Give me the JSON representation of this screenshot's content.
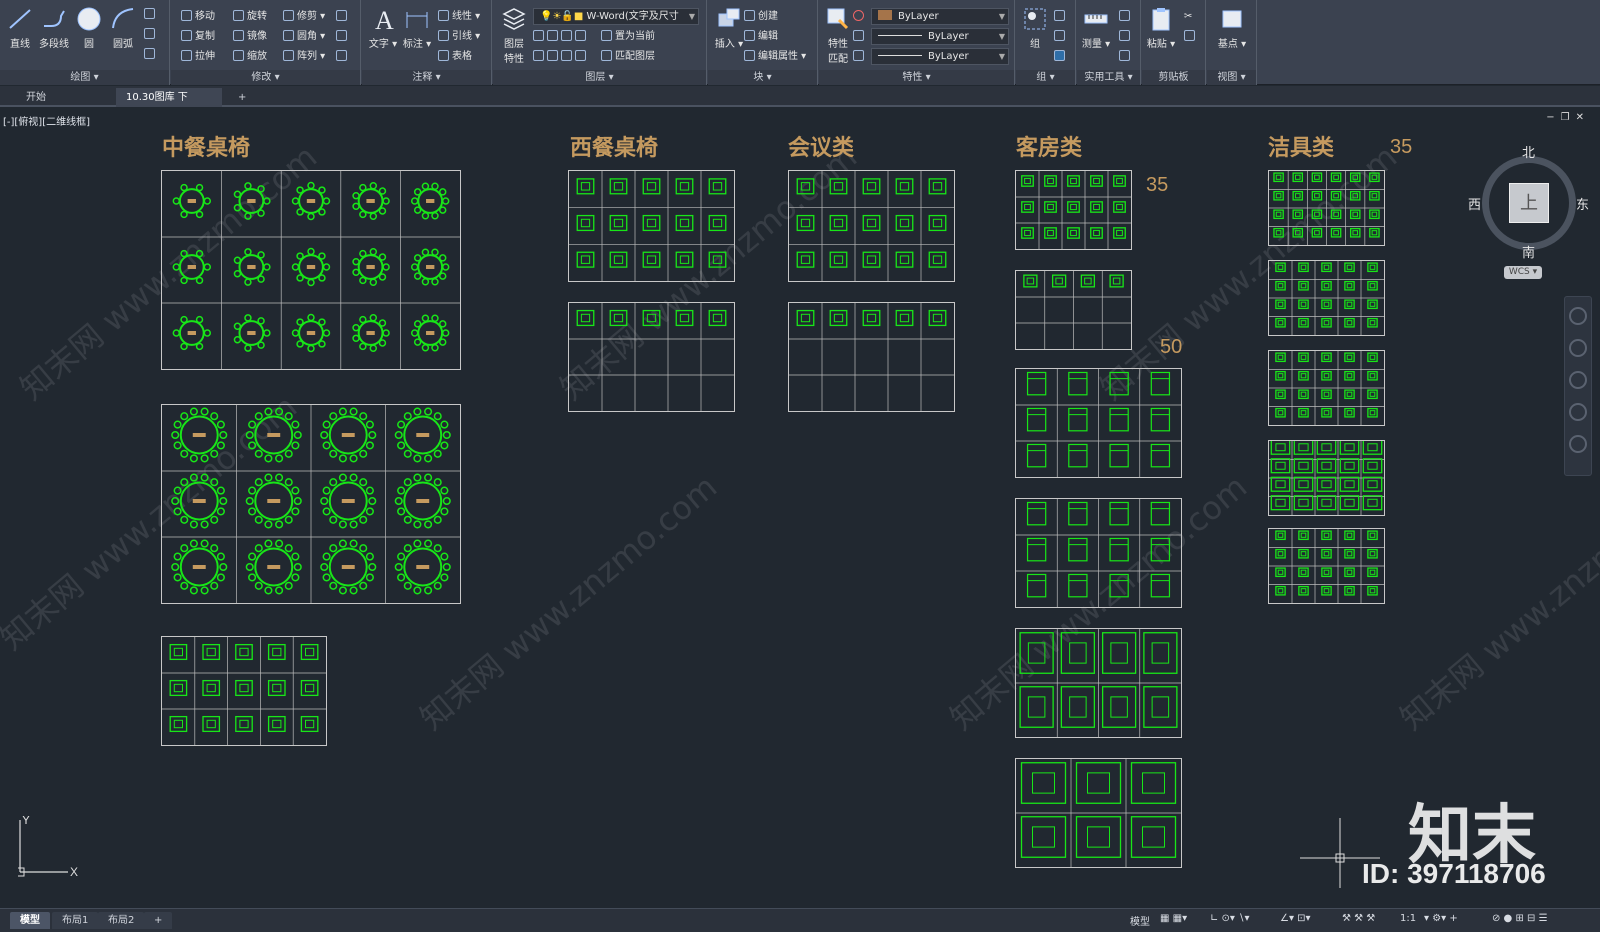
{
  "ribbon": {
    "panels": {
      "draw": "绘图",
      "modify": "修改",
      "annotate": "注释",
      "layers": "图层",
      "block": "块",
      "properties": "特性",
      "groups": "组",
      "utilities": "实用工具",
      "clipboard": "剪贴板",
      "view": "视图"
    },
    "draw_tools": [
      "直线",
      "多段线",
      "圆",
      "圆弧"
    ],
    "modify_tools": [
      "移动",
      "旋转",
      "修剪",
      "复制",
      "镜像",
      "圆角",
      "拉伸",
      "缩放",
      "阵列"
    ],
    "annotate_tools": {
      "text": "文字",
      "dimension": "标注",
      "linear": "线性",
      "leader": "引线",
      "table": "表格"
    },
    "layer_tools": {
      "props": "图层\n特性",
      "current_layer": "W-Word(文字及尺寸",
      "set_current": "置为当前",
      "match": "匹配图层"
    },
    "block_tools": {
      "insert": "插入",
      "create": "创建",
      "edit": "编辑",
      "edit_attr": "编辑属性"
    },
    "property_tools": {
      "match": "特性\n匹配",
      "color": "ByLayer",
      "linetype": "ByLayer",
      "lineweight": "ByLayer"
    },
    "group_tool": "组",
    "measure_tool": "测量",
    "paste_tool": "粘贴",
    "base_tool": "基点"
  },
  "file_tabs": [
    {
      "label": "开始",
      "active": false
    },
    {
      "label": "10.30图库 下*",
      "active": true
    }
  ],
  "canvas": {
    "view_label": "[-][俯视][二维线框]",
    "categories": {
      "chinese_dining": "中餐桌椅",
      "western_dining": "西餐桌椅",
      "meeting": "会议类",
      "guest_room": "客房类",
      "sanitary": "洁具类"
    },
    "numbers": {
      "guest_room_count": "35",
      "guest_room_count_2": "50",
      "sanitary_count": "35"
    },
    "viewcube": {
      "north": "北",
      "south": "南",
      "west": "西",
      "east": "东",
      "face": "上",
      "wcs": "WCS"
    },
    "ucs": {
      "x": "X",
      "y": "Y"
    },
    "watermark_text": "知末网 www.znzmo.com",
    "brand": "知末",
    "id_label": "ID: 397118706"
  },
  "layout_tabs": [
    "模型",
    "布局1",
    "布局2"
  ],
  "status": {
    "model": "模型",
    "scale": "1:1"
  },
  "colors": {
    "accent_title": "#c59a5f",
    "cad_green": "#18e618",
    "background": "#212830",
    "ribbon": "#3b4250"
  }
}
